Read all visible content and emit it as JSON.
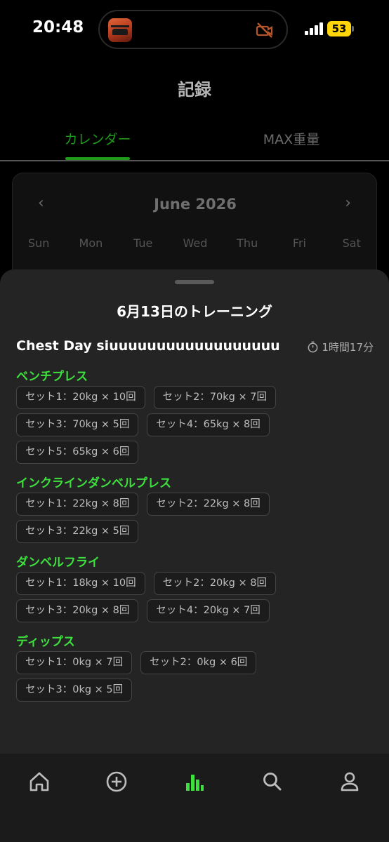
{
  "status_bar": {
    "time": "20:48",
    "battery": "53",
    "app_icon": "f1-car-app-icon",
    "indicator_icon": "muted-camera-icon"
  },
  "header": {
    "title": "記録",
    "tabs": [
      {
        "label": "カレンダー",
        "active": true
      },
      {
        "label": "MAX重量",
        "active": false
      }
    ]
  },
  "calendar": {
    "month": "June 2026",
    "weekdays": [
      "Sun",
      "Mon",
      "Tue",
      "Wed",
      "Thu",
      "Fri",
      "Sat"
    ]
  },
  "sheet": {
    "title": "6月13日のトレーニング",
    "workout_name": "Chest Day siuuuuuuuuuuuuuuuuuu",
    "duration": "1時間17分",
    "exercises": [
      {
        "name": "ベンチプレス",
        "sets": [
          "セット1：20kg × 10回",
          "セット2：70kg × 7回",
          "セット3：70kg × 5回",
          "セット4：65kg × 8回",
          "セット5：65kg × 6回"
        ]
      },
      {
        "name": "インクラインダンベルプレス",
        "sets": [
          "セット1：22kg × 8回",
          "セット2：22kg × 8回",
          "セット3：22kg × 5回"
        ]
      },
      {
        "name": "ダンベルフライ",
        "sets": [
          "セット1：18kg × 10回",
          "セット2：20kg × 8回",
          "セット3：20kg × 8回",
          "セット4：20kg × 7回"
        ]
      },
      {
        "name": "ディップス",
        "sets": [
          "セット1：0kg × 7回",
          "セット2：0kg × 6回",
          "セット3：0kg × 5回"
        ]
      }
    ]
  },
  "bottom_nav": {
    "items": [
      {
        "icon": "home-icon",
        "active": false
      },
      {
        "icon": "add-circle-icon",
        "active": false
      },
      {
        "icon": "bar-chart-icon",
        "active": true
      },
      {
        "icon": "search-icon",
        "active": false
      },
      {
        "icon": "profile-icon",
        "active": false
      }
    ]
  },
  "colors": {
    "accent": "#3ee03e",
    "tab_active": "#1f9a1a",
    "sheet_bg": "#242424",
    "background": "#000000"
  }
}
